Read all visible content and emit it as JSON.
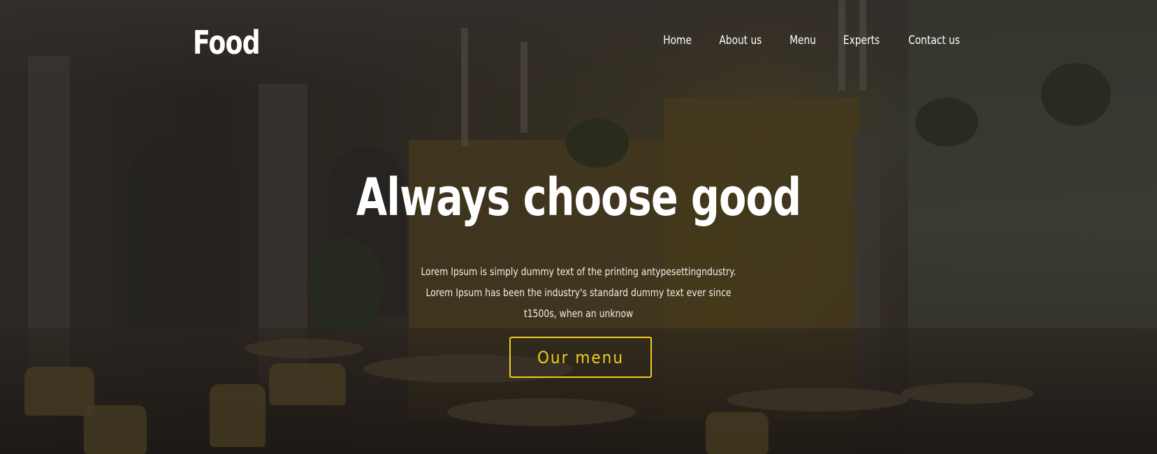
{
  "header": {
    "logo": "Food",
    "nav": [
      "Home",
      "About us",
      "Menu",
      "Experts",
      "Contact us"
    ]
  },
  "hero": {
    "headline": "Always choose good",
    "description": "Lorem Ipsum is simply dummy text of the printing antypesettingndustry. Lorem Ipsum has been the industry's standard dummy text ever since t1500s, when an unknow",
    "cta_label": "Our menu"
  },
  "colors": {
    "accent": "#f2cc1f",
    "text": "#ffffff"
  }
}
